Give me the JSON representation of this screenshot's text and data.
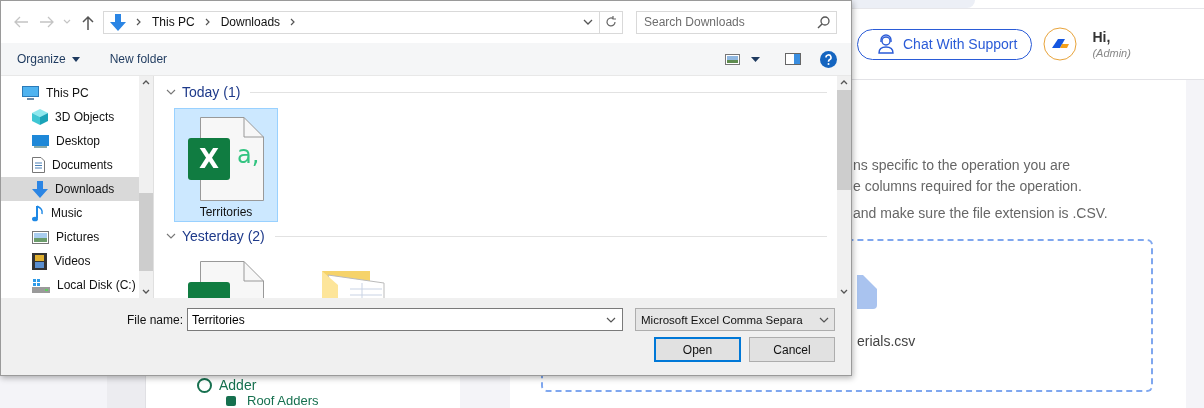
{
  "page": {
    "support_button": "Chat With Support",
    "greeting": "Hi,",
    "role": "(Admin)",
    "instructions": [
      "ns specific to the operation you are",
      "e columns required for the operation.",
      "and make sure the file extension is .CSV."
    ],
    "drop_zone": {
      "file_name": "erials.csv"
    },
    "sidebar": [
      {
        "label": "Adder",
        "kind": "section"
      },
      {
        "label": "Roof Adders",
        "kind": "item"
      }
    ]
  },
  "dialog": {
    "breadcrumb": [
      "This PC",
      "Downloads"
    ],
    "search": {
      "placeholder": "Search Downloads"
    },
    "toolbar": {
      "organize": "Organize",
      "new_folder": "New folder"
    },
    "nav_pane": [
      {
        "label": "This PC",
        "kind": "pc",
        "selected": false,
        "children": [
          {
            "label": "3D Objects",
            "kind": "cube",
            "selected": false
          },
          {
            "label": "Desktop",
            "kind": "desktop",
            "selected": false
          },
          {
            "label": "Documents",
            "kind": "document",
            "selected": false
          },
          {
            "label": "Downloads",
            "kind": "download",
            "selected": true
          },
          {
            "label": "Music",
            "kind": "music",
            "selected": false
          },
          {
            "label": "Pictures",
            "kind": "pictures",
            "selected": false
          },
          {
            "label": "Videos",
            "kind": "videos",
            "selected": false
          },
          {
            "label": "Local Disk (C:)",
            "kind": "disk",
            "selected": false
          }
        ]
      }
    ],
    "groups": [
      {
        "title": "Today (1)",
        "expanded": true,
        "files": [
          {
            "name": "Territories",
            "kind": "excel",
            "badge": "X",
            "suffix": "a,",
            "selected": true
          }
        ]
      },
      {
        "title": "Yesterday (2)",
        "expanded": true,
        "files": [
          {
            "kind": "excel",
            "selected": false
          },
          {
            "kind": "folder",
            "selected": false
          }
        ]
      }
    ],
    "file_name_label": "File name:",
    "file_name": "Territories",
    "file_type": "Microsoft Excel Comma Separa",
    "buttons": [
      {
        "label": "Open",
        "default": true
      },
      {
        "label": "Cancel",
        "default": false
      }
    ]
  }
}
